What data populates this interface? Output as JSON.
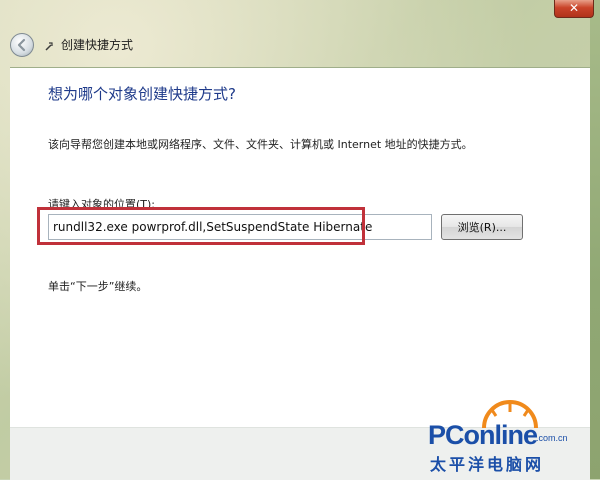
{
  "window": {
    "title": "创建快捷方式",
    "close_glyph": "✕"
  },
  "wizard": {
    "heading": "想为哪个对象创建快捷方式?",
    "description": "该向导帮您创建本地或网络程序、文件、文件夹、计算机或 Internet 地址的快捷方式。",
    "location_label": "请键入对象的位置(T):",
    "location_value": "rundll32.exe powrprof.dll,SetSuspendState Hibernate",
    "browse_label": "浏览(R)...",
    "next_hint": "单击“下一步”继续。"
  },
  "watermark": {
    "brand": "PConline",
    "domain": ".com.cn",
    "chinese": "太平洋电脑网"
  },
  "colors": {
    "highlight": "#c0313a",
    "heading": "#1e3a8a",
    "brand_blue": "#1b4fa8",
    "brand_orange": "#f08a1c"
  },
  "icons": [
    "back-arrow-icon",
    "wizard-icon",
    "close-icon"
  ]
}
